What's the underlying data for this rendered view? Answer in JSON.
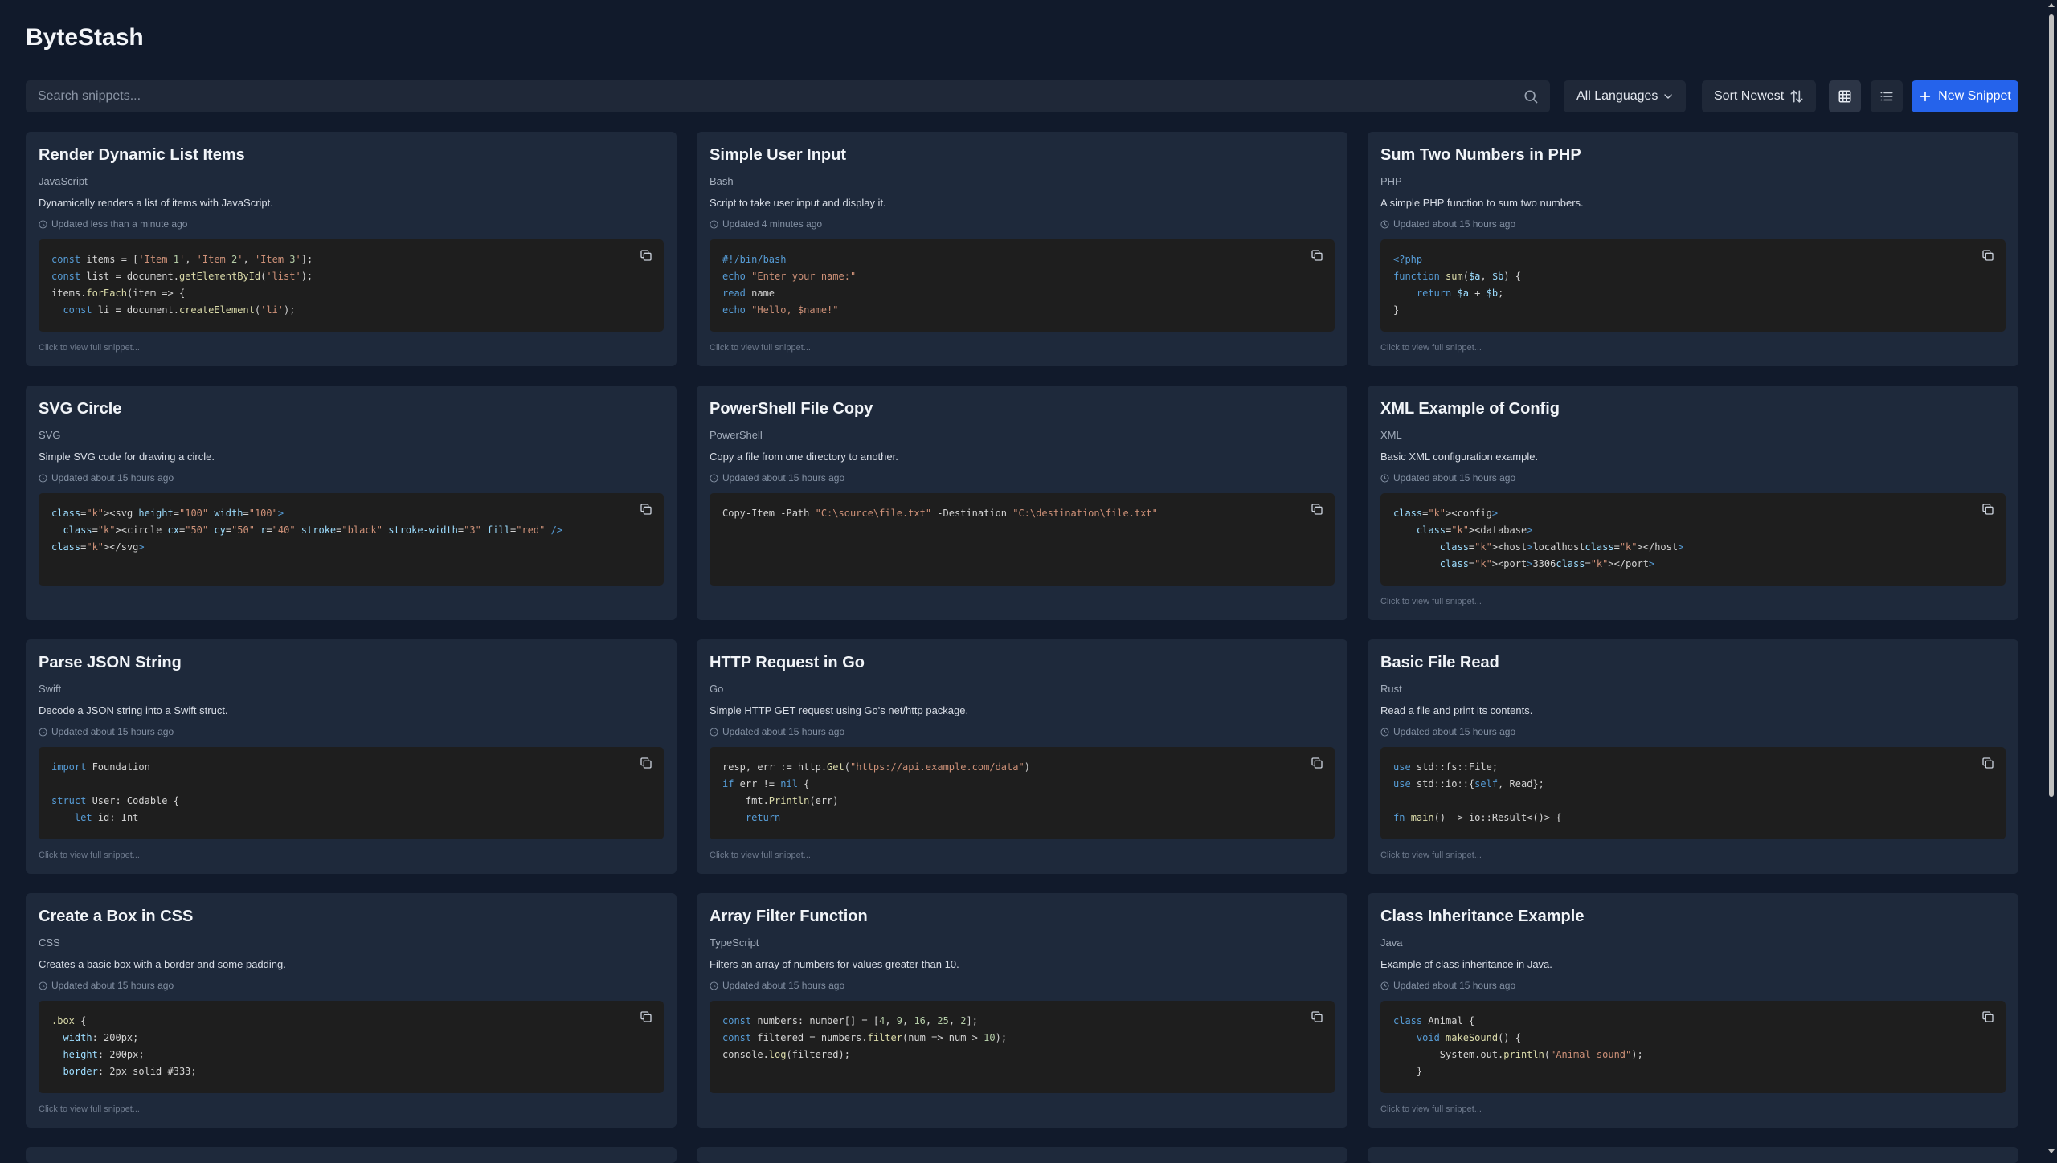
{
  "app": {
    "title": "ByteStash"
  },
  "toolbar": {
    "search_placeholder": "Search snippets...",
    "language_filter": "All Languages",
    "sort": "Sort Newest",
    "new_button": "New Snippet",
    "view_modes": [
      "grid-view",
      "list-view"
    ],
    "active_view": "grid-view"
  },
  "colors": {
    "background": "#111a2b",
    "card": "#1e293b",
    "code_bg": "#1e1e1e",
    "accent": "#2563eb"
  },
  "snippets": [
    {
      "title": "Render Dynamic List Items",
      "language": "JavaScript",
      "description": "Dynamically renders a list of items with JavaScript.",
      "updated": "Updated less than a minute ago",
      "footer": "Click to view full snippet...",
      "code": "const items = ['Item 1', 'Item 2', 'Item 3'];\nconst list = document.getElementById('list');\nitems.forEach(item => {\n  const li = document.createElement('li');"
    },
    {
      "title": "Simple User Input",
      "language": "Bash",
      "description": "Script to take user input and display it.",
      "updated": "Updated 4 minutes ago",
      "footer": "Click to view full snippet...",
      "code": "#!/bin/bash\necho \"Enter your name:\"\nread name\necho \"Hello, $name!\""
    },
    {
      "title": "Sum Two Numbers in PHP",
      "language": "PHP",
      "description": "A simple PHP function to sum two numbers.",
      "updated": "Updated about 15 hours ago",
      "footer": "Click to view full snippet...",
      "code": "<?php\nfunction sum($a, $b) {\n    return $a + $b;\n}"
    },
    {
      "title": "SVG Circle",
      "language": "SVG",
      "description": "Simple SVG code for drawing a circle.",
      "updated": "Updated about 15 hours ago",
      "footer": "",
      "code": "<svg height=\"100\" width=\"100\">\n  <circle cx=\"50\" cy=\"50\" r=\"40\" stroke=\"black\" stroke-width=\"3\" fill=\"red\" />\n</svg>"
    },
    {
      "title": "PowerShell File Copy",
      "language": "PowerShell",
      "description": "Copy a file from one directory to another.",
      "updated": "Updated about 15 hours ago",
      "footer": "",
      "code": "Copy-Item -Path \"C:\\source\\file.txt\" -Destination \"C:\\destination\\file.txt\""
    },
    {
      "title": "XML Example of Config",
      "language": "XML",
      "description": "Basic XML configuration example.",
      "updated": "Updated about 15 hours ago",
      "footer": "Click to view full snippet...",
      "code": "<config>\n    <database>\n        <host>localhost</host>\n        <port>3306</port>"
    },
    {
      "title": "Parse JSON String",
      "language": "Swift",
      "description": "Decode a JSON string into a Swift struct.",
      "updated": "Updated about 15 hours ago",
      "footer": "Click to view full snippet...",
      "code": "import Foundation\n\nstruct User: Codable {\n    let id: Int"
    },
    {
      "title": "HTTP Request in Go",
      "language": "Go",
      "description": "Simple HTTP GET request using Go's net/http package.",
      "updated": "Updated about 15 hours ago",
      "footer": "Click to view full snippet...",
      "code": "resp, err := http.Get(\"https://api.example.com/data\")\nif err != nil {\n    fmt.Println(err)\n    return"
    },
    {
      "title": "Basic File Read",
      "language": "Rust",
      "description": "Read a file and print its contents.",
      "updated": "Updated about 15 hours ago",
      "footer": "Click to view full snippet...",
      "code": "use std::fs::File;\nuse std::io::{self, Read};\n\nfn main() -> io::Result<()> {"
    },
    {
      "title": "Create a Box in CSS",
      "language": "CSS",
      "description": "Creates a basic box with a border and some padding.",
      "updated": "Updated about 15 hours ago",
      "footer": "Click to view full snippet...",
      "code": ".box {\n  width: 200px;\n  height: 200px;\n  border: 2px solid #333;"
    },
    {
      "title": "Array Filter Function",
      "language": "TypeScript",
      "description": "Filters an array of numbers for values greater than 10.",
      "updated": "Updated about 15 hours ago",
      "footer": "",
      "code": "const numbers: number[] = [4, 9, 16, 25, 2];\nconst filtered = numbers.filter(num => num > 10);\nconsole.log(filtered);"
    },
    {
      "title": "Class Inheritance Example",
      "language": "Java",
      "description": "Example of class inheritance in Java.",
      "updated": "Updated about 15 hours ago",
      "footer": "Click to view full snippet...",
      "code": "class Animal {\n    void makeSound() {\n        System.out.println(\"Animal sound\");\n    }"
    }
  ]
}
